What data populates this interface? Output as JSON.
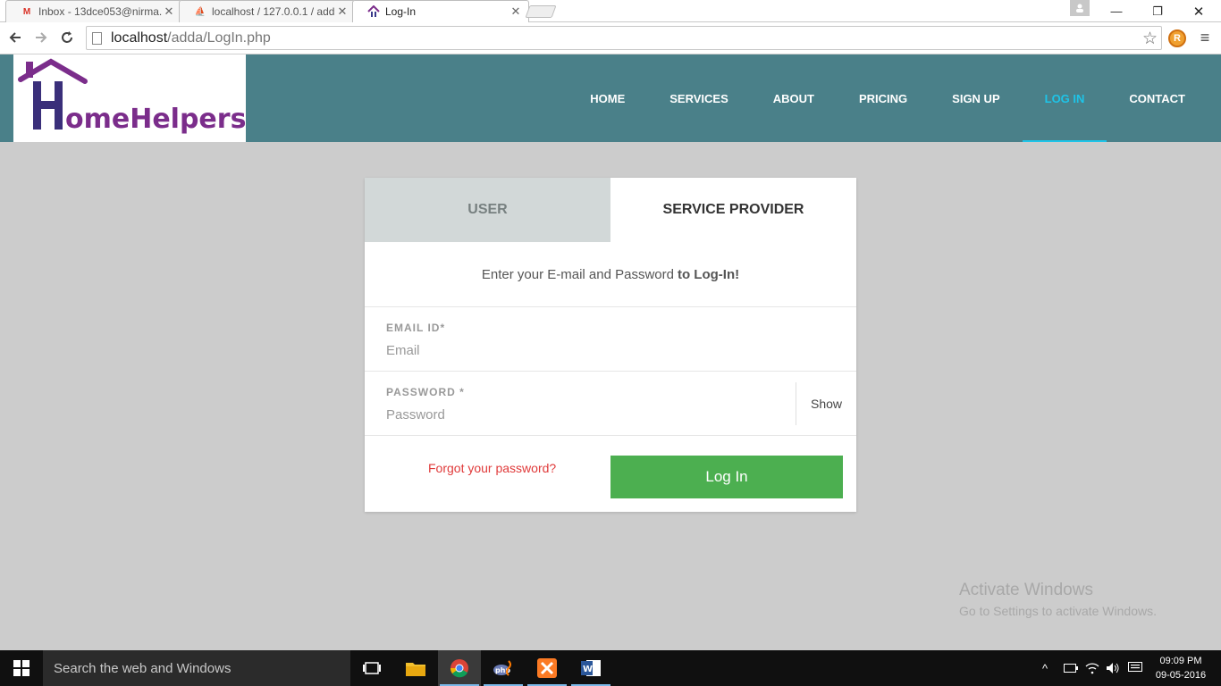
{
  "browser": {
    "tabs": [
      {
        "title": "Inbox - 13dce053@nirma.",
        "favicon": "gmail-icon"
      },
      {
        "title": "localhost / 127.0.0.1 / add",
        "favicon": "phpmyadmin-icon"
      },
      {
        "title": "Log-In",
        "favicon": "homehelpers-icon"
      }
    ],
    "url_host": "localhost",
    "url_path": "/adda/LogIn.php"
  },
  "site": {
    "logo_text": "HomeHelpers",
    "nav": [
      {
        "label": "HOME"
      },
      {
        "label": "SERVICES"
      },
      {
        "label": "ABOUT"
      },
      {
        "label": "PRICING"
      },
      {
        "label": "SIGN UP"
      },
      {
        "label": "LOG IN",
        "active": true
      },
      {
        "label": "CONTACT"
      }
    ]
  },
  "login": {
    "tab_user": "USER",
    "tab_provider": "SERVICE PROVIDER",
    "intro_text": "Enter your E-mail and Password",
    "intro_bold": "to Log-In!",
    "email_label": "EMAIL ID*",
    "email_placeholder": "Email",
    "password_label": "PASSWORD *",
    "password_placeholder": "Password",
    "show_label": "Show",
    "forgot_label": "Forgot your password?",
    "login_button": "Log In"
  },
  "watermark": {
    "line1": "Activate Windows",
    "line2": "Go to Settings to activate Windows."
  },
  "taskbar": {
    "search_placeholder": "Search the web and Windows",
    "time": "09:09 PM",
    "date": "09-05-2016"
  },
  "colors": {
    "header_bg": "#4a8089",
    "nav_active": "#1ec4e8",
    "login_button": "#4caf50",
    "forgot_link": "#e03a3a",
    "logo_purple": "#7b2d8b"
  }
}
